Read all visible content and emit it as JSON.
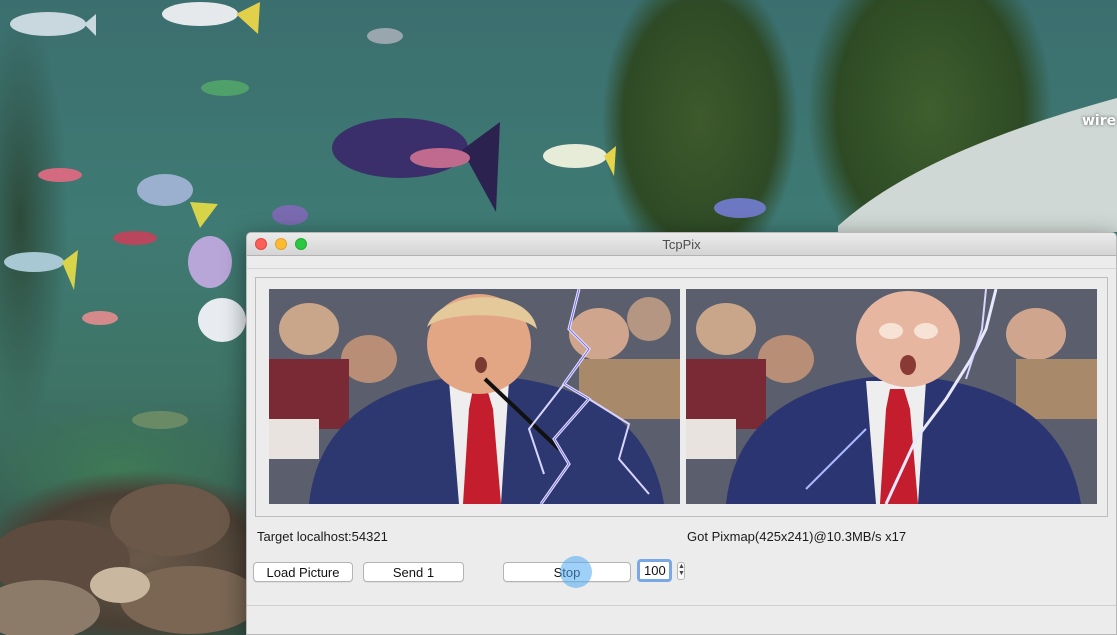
{
  "desktop": {
    "overlay_text": "wire"
  },
  "window": {
    "title": "TcpPix",
    "status_left": "Target localhost:54321",
    "status_right": "Got Pixmap(425x241)@10.3MB/s x17",
    "buttons": {
      "load_picture": "Load Picture",
      "send_one": "Send 1",
      "stop": "Stop"
    },
    "spinbox_value": "100"
  },
  "colors": {
    "window_bg": "#ececec",
    "spin_focus": "#7aa7e6",
    "click_indicator": "#50aaf0"
  }
}
